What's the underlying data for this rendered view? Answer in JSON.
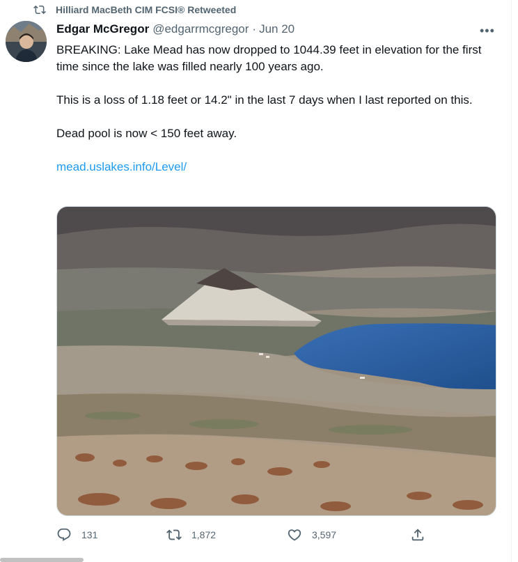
{
  "retweet_banner": {
    "text": "Hilliard MacBeth CIM FCSI® Retweeted",
    "icon": "retweet-icon"
  },
  "tweet": {
    "author_name": "Edgar McGregor",
    "author_handle": "@edgarrmcgregor",
    "separator": "·",
    "date": "Jun 20",
    "more_icon": "more-icon",
    "paragraphs": [
      "BREAKING: Lake Mead has now dropped to 1044.39 feet in elevation for the first time since the lake was filled nearly 100 years ago.",
      "This is a loss of 1.18 feet or 14.2\" in the last 7 days when I last reported on this.",
      "Dead pool is now < 150 feet away."
    ],
    "link_text": "mead.uslakes.info/Level/",
    "media_alt": "photo",
    "actions": {
      "replies": "131",
      "retweets": "1,872",
      "likes": "3,597"
    }
  },
  "colors": {
    "text": "#0f1419",
    "secondary": "#536471",
    "link": "#1d9bf0",
    "lake": "#2b63a8"
  }
}
